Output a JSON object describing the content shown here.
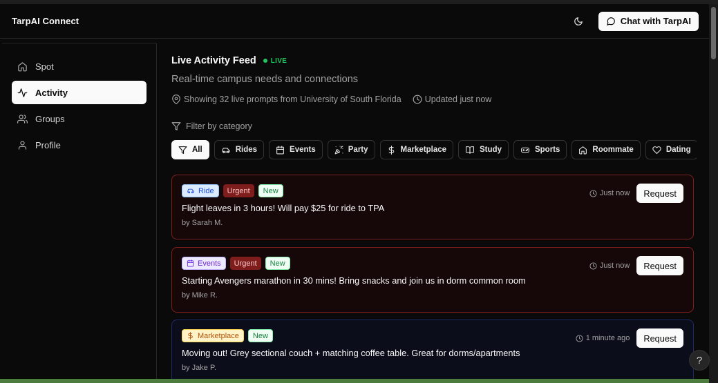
{
  "app": {
    "brand": "TarpAI Connect",
    "chat_button": "Chat with TarpAI",
    "help": "?"
  },
  "sidebar": {
    "items": [
      {
        "label": "Spot",
        "icon": "home-icon",
        "active": false
      },
      {
        "label": "Activity",
        "icon": "activity-icon",
        "active": true
      },
      {
        "label": "Groups",
        "icon": "users-icon",
        "active": false
      },
      {
        "label": "Profile",
        "icon": "user-icon",
        "active": false
      }
    ]
  },
  "feed": {
    "title": "Live Activity Feed",
    "live_badge": "LIVE",
    "subtitle": "Real-time campus needs and connections",
    "location_text": "Showing 32 live prompts from University of South Florida",
    "updated_text": "Updated just now",
    "filter_label": "Filter by category",
    "filters": [
      {
        "label": "All",
        "icon": "filter-icon",
        "active": true
      },
      {
        "label": "Rides",
        "icon": "car-icon",
        "active": false
      },
      {
        "label": "Events",
        "icon": "calendar-icon",
        "active": false
      },
      {
        "label": "Party",
        "icon": "party-icon",
        "active": false
      },
      {
        "label": "Marketplace",
        "icon": "dollar-icon",
        "active": false
      },
      {
        "label": "Study",
        "icon": "book-icon",
        "active": false
      },
      {
        "label": "Sports",
        "icon": "gamepad-icon",
        "active": false
      },
      {
        "label": "Roommate",
        "icon": "home-icon",
        "active": false
      },
      {
        "label": "Dating",
        "icon": "heart-icon",
        "active": false
      }
    ],
    "cards": [
      {
        "category": "Ride",
        "urgent_label": "Urgent",
        "new_label": "New",
        "text": "Flight leaves in 3 hours! Will pay $25 for ride to TPA",
        "by": "by Sarah M.",
        "time": "Just now",
        "request_label": "Request"
      },
      {
        "category": "Events",
        "urgent_label": "Urgent",
        "new_label": "New",
        "text": "Starting Avengers marathon in 30 mins! Bring snacks and join us in dorm common room",
        "by": "by Mike R.",
        "time": "Just now",
        "request_label": "Request"
      },
      {
        "category": "Marketplace",
        "new_label": "New",
        "text": "Moving out! Grey sectional couch + matching coffee table. Great for dorms/apartments",
        "by": "by Jake P.",
        "time": "1 minute ago",
        "request_label": "Request"
      }
    ]
  },
  "colors": {
    "background": "#0a0a0a",
    "live_green": "#22c55e",
    "urgent_border": "#7f1d1d",
    "normal_border": "#1e2a6b"
  }
}
